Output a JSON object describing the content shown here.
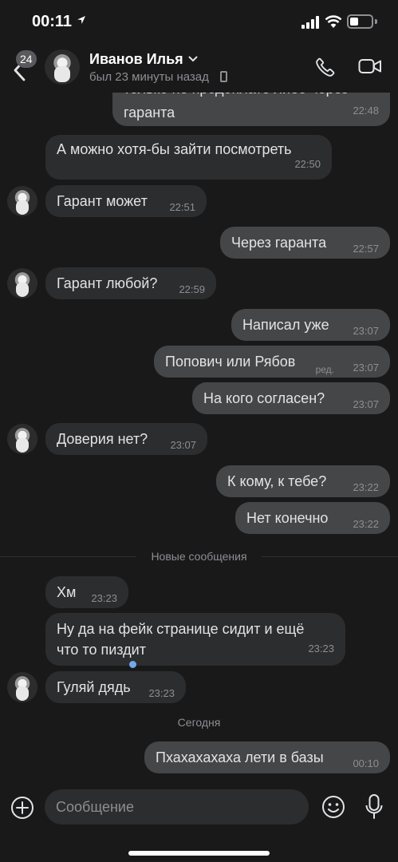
{
  "status_bar": {
    "time": "00:11"
  },
  "header": {
    "unread_count": "24",
    "contact_name": "Иванов Илья",
    "last_seen": "был 23 минуты назад"
  },
  "messages": [
    {
      "dir": "out",
      "text": "только не предоплате либо через гаранта",
      "time": "22:48",
      "partial": true
    },
    {
      "dir": "in",
      "text": "А можно хотя-бы зайти посмотреть",
      "time": "22:50"
    },
    {
      "dir": "in",
      "text": "Гарант может",
      "time": "22:51",
      "avatar": true
    },
    {
      "dir": "out",
      "text": "Через гаранта",
      "time": "22:57"
    },
    {
      "dir": "in",
      "text": "Гарант любой?",
      "time": "22:59",
      "avatar": true
    },
    {
      "dir": "out",
      "text": "Написал уже",
      "time": "23:07"
    },
    {
      "dir": "out",
      "text": "Попович или Рябов",
      "time": "23:07",
      "edited": "ред."
    },
    {
      "dir": "out",
      "text": "На кого согласен?",
      "time": "23:07"
    },
    {
      "dir": "in",
      "text": "Доверия нет?",
      "time": "23:07",
      "avatar": true
    },
    {
      "dir": "out",
      "text": "К кому, к тебе?",
      "time": "23:22"
    },
    {
      "dir": "out",
      "text": "Нет конечно",
      "time": "23:22"
    },
    {
      "dir": "in",
      "text": "Хм",
      "time": "23:23"
    },
    {
      "dir": "in",
      "text": "Ну да на фейк странице сидит и ещё что то пиздит",
      "time": "23:23"
    },
    {
      "dir": "in",
      "text": "Гуляй дядь",
      "time": "23:23",
      "avatar": true
    },
    {
      "dir": "out",
      "text": "Пхахахахаха лети в базы",
      "time": "00:10",
      "unread": true
    }
  ],
  "dividers": {
    "new_messages": "Новые сообщения",
    "today": "Сегодня"
  },
  "composer": {
    "placeholder": "Сообщение"
  },
  "colors": {
    "background": "#19191a",
    "incoming": "#2c2d2e",
    "outgoing": "#454647",
    "accent": "#71aaeb"
  }
}
